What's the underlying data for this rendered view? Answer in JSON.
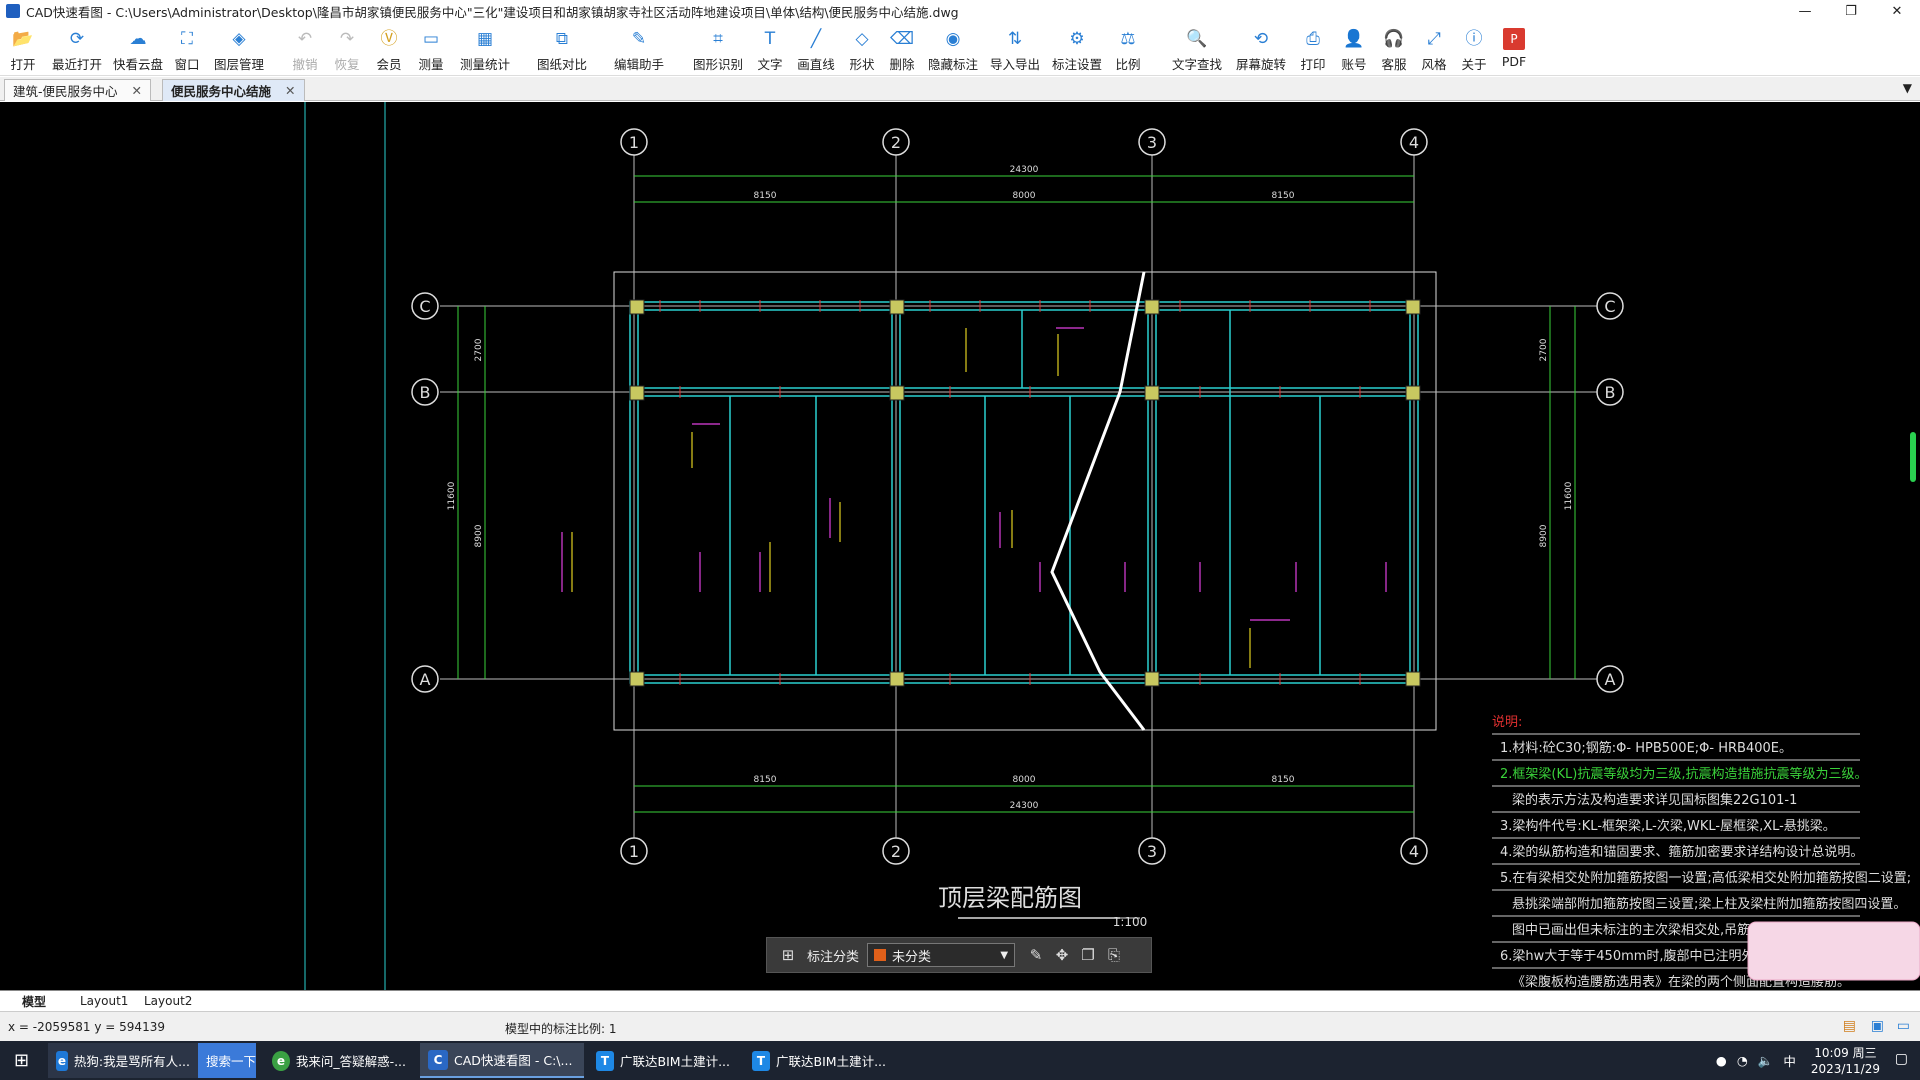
{
  "window": {
    "app_name": "CAD快速看图",
    "title": "CAD快速看图 - C:\\Users\\Administrator\\Desktop\\隆昌市胡家镇便民服务中心\"三化\"建设项目和胡家镇胡家寺社区活动阵地建设项目\\单体\\结构\\便民服务中心结施.dwg",
    "controls": [
      "—",
      "❐",
      "✕"
    ]
  },
  "toolbar": [
    {
      "label": "打开",
      "icon": "folder-icon",
      "glyph": "📂",
      "disabled": false
    },
    {
      "label": "最近打开",
      "icon": "recent-icon",
      "glyph": "⟳",
      "disabled": false
    },
    {
      "label": "快看云盘",
      "icon": "cloud-icon",
      "glyph": "☁",
      "disabled": false
    },
    {
      "label": "窗口",
      "icon": "window-icon",
      "glyph": "⛶",
      "disabled": false
    },
    {
      "label": "图层管理",
      "icon": "layers-icon",
      "glyph": "◈",
      "disabled": false
    },
    {
      "label": "撤销",
      "icon": "undo-icon",
      "glyph": "↶",
      "disabled": true
    },
    {
      "label": "恢复",
      "icon": "redo-icon",
      "glyph": "↷",
      "disabled": true
    },
    {
      "label": "会员",
      "icon": "vip-icon",
      "glyph": "Ⓥ",
      "disabled": false
    },
    {
      "label": "测量",
      "icon": "measure-icon",
      "glyph": "▭",
      "disabled": false
    },
    {
      "label": "测量统计",
      "icon": "measure-stats-icon",
      "glyph": "▦",
      "disabled": false
    },
    {
      "label": "图纸对比",
      "icon": "compare-icon",
      "glyph": "⧉",
      "disabled": false
    },
    {
      "label": "编辑助手",
      "icon": "edit-assistant-icon",
      "glyph": "✎",
      "disabled": false
    },
    {
      "label": "图形识别",
      "icon": "shape-recognize-icon",
      "glyph": "⌗",
      "disabled": false
    },
    {
      "label": "文字",
      "icon": "text-icon",
      "glyph": "T",
      "disabled": false
    },
    {
      "label": "画直线",
      "icon": "line-icon",
      "glyph": "╱",
      "disabled": false
    },
    {
      "label": "形状",
      "icon": "shape-icon",
      "glyph": "◇",
      "disabled": false
    },
    {
      "label": "删除",
      "icon": "eraser-icon",
      "glyph": "⌫",
      "disabled": false
    },
    {
      "label": "隐藏标注",
      "icon": "hide-mark-icon",
      "glyph": "◉",
      "disabled": false
    },
    {
      "label": "导入导出",
      "icon": "import-export-icon",
      "glyph": "⇅",
      "disabled": false
    },
    {
      "label": "标注设置",
      "icon": "mark-settings-icon",
      "glyph": "⚙",
      "disabled": false
    },
    {
      "label": "比例",
      "icon": "scale-icon",
      "glyph": "⚖",
      "disabled": false
    },
    {
      "label": "文字查找",
      "icon": "text-search-icon",
      "glyph": "🔍",
      "disabled": false
    },
    {
      "label": "屏幕旋转",
      "icon": "rotate-icon",
      "glyph": "⟲",
      "disabled": false
    },
    {
      "label": "打印",
      "icon": "print-icon",
      "glyph": "⎙",
      "disabled": false
    },
    {
      "label": "账号",
      "icon": "account-icon",
      "glyph": "👤",
      "disabled": false
    },
    {
      "label": "客服",
      "icon": "support-icon",
      "glyph": "🎧",
      "disabled": false
    },
    {
      "label": "风格",
      "icon": "style-icon",
      "glyph": "⤢",
      "disabled": false
    },
    {
      "label": "关于",
      "icon": "about-icon",
      "glyph": "ⓘ",
      "disabled": false
    },
    {
      "label": "PDF",
      "icon": "pdf-icon",
      "glyph": "P",
      "disabled": false
    }
  ],
  "tabs": [
    {
      "label": "建筑-便民服务中心",
      "active": false
    },
    {
      "label": "便民服务中心结施",
      "active": true
    }
  ],
  "drawing": {
    "title": "顶层梁配筋图",
    "scale": "1:100",
    "axes_top": [
      "1",
      "2",
      "3",
      "4"
    ],
    "axes_side": [
      "C",
      "B",
      "A"
    ],
    "dims_top_total": "24300",
    "dims_top_parts": [
      "8150",
      "8000",
      "8150"
    ],
    "dims_side_outer": "11600",
    "dims_side_parts": [
      "2700",
      "8900"
    ],
    "notes_title": "说明:",
    "notes": [
      "1.材料:砼C30;钢筋:Φ- HPB500E;Φ- HRB400E。",
      "2.框架梁(KL)抗震等级均为三级,抗震构造措施抗震等级为三级。",
      "梁的表示方法及构造要求详见国标图集22G101-1",
      "3.梁构件代号:KL-框架梁,L-次梁,WKL-屋框梁,XL-悬挑梁。",
      "4.梁的纵筋构造和锚固要求、箍筋加密要求详结构设计总说明。",
      "5.在有梁相交处附加箍筋按图一设置;高低梁相交处附加箍筋按图二设置;",
      "悬挑梁端部附加箍筋按图三设置;梁上柱及梁柱附加箍筋按图四设置。",
      "图中已画出但未标注的主次梁相交处,吊筋均2Φ16,具余位置",
      "6.梁hw大于等于450mm时,腹部中已注明外,按结构设计总说",
      "《梁腹板构造腰筋选用表》在梁的两个侧面配置构造腰筋。"
    ]
  },
  "mark_toolbar": {
    "label": "标注分类",
    "selected": "未分类",
    "color": "#e0601a"
  },
  "layouts": [
    "模型",
    "Layout1",
    "Layout2"
  ],
  "status": {
    "coords": "x = -2059581  y = 594139",
    "scale_text": "模型中的标注比例: 1"
  },
  "taskbar": {
    "items": [
      {
        "label": "热狗:我是骂所有人...",
        "icon": "ie-icon"
      },
      {
        "label": "搜索一下",
        "icon": "search-icon"
      },
      {
        "label": "我来问_答疑解惑-...",
        "icon": "browser-icon"
      },
      {
        "label": "CAD快速看图 - C:\\...",
        "icon": "cad-icon"
      },
      {
        "label": "广联达BIM土建计...",
        "icon": "glodon-icon"
      },
      {
        "label": "广联达BIM土建计...",
        "icon": "glodon-icon"
      }
    ],
    "ime": "中",
    "time": "10:09 周三",
    "date": "2023/11/29"
  }
}
